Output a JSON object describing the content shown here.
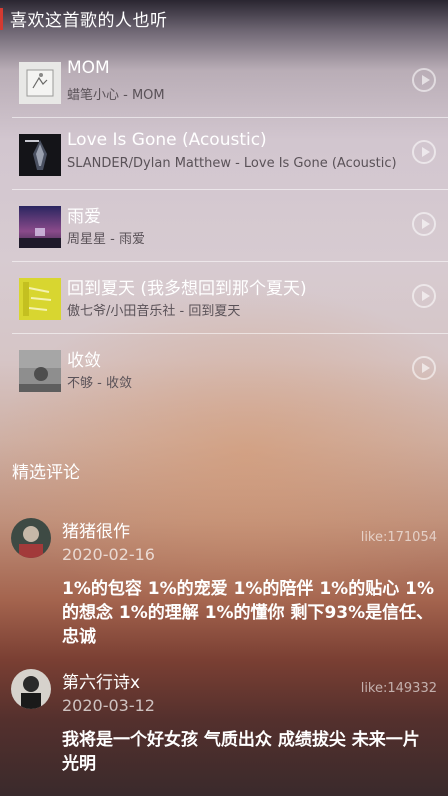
{
  "recommend": {
    "title": "喜欢这首歌的人也听",
    "songs": [
      {
        "title": "MOM",
        "subtitle": "蜡笔小心 - MOM"
      },
      {
        "title": "Love Is Gone (Acoustic)",
        "subtitle": "SLANDER/Dylan Matthew - Love Is Gone (Acoustic)"
      },
      {
        "title": "雨爱",
        "subtitle": "周星星 - 雨爱"
      },
      {
        "title": "回到夏天 (我多想回到那个夏天)",
        "subtitle": "傲七爷/小田音乐社 - 回到夏天"
      },
      {
        "title": "收敛",
        "subtitle": "不够 - 收敛"
      }
    ]
  },
  "comments": {
    "title": "精选评论",
    "items": [
      {
        "user": "猪猪很作",
        "date": "2020-02-16",
        "likes": "like:171054",
        "text": "1%的包容 1%的宠爱 1%的陪伴 1%的贴心 1%的想念 1%的理解 1%的懂你 剩下93%是信任、忠诚"
      },
      {
        "user": "第六行诗x",
        "date": "2020-03-12",
        "likes": "like:149332",
        "text": "我将是一个好女孩 气质出众 成绩拔尖 未来一片光明"
      }
    ]
  },
  "colors": {
    "accent": "#d33a31"
  },
  "icons": {
    "play": "play-circle-icon"
  }
}
